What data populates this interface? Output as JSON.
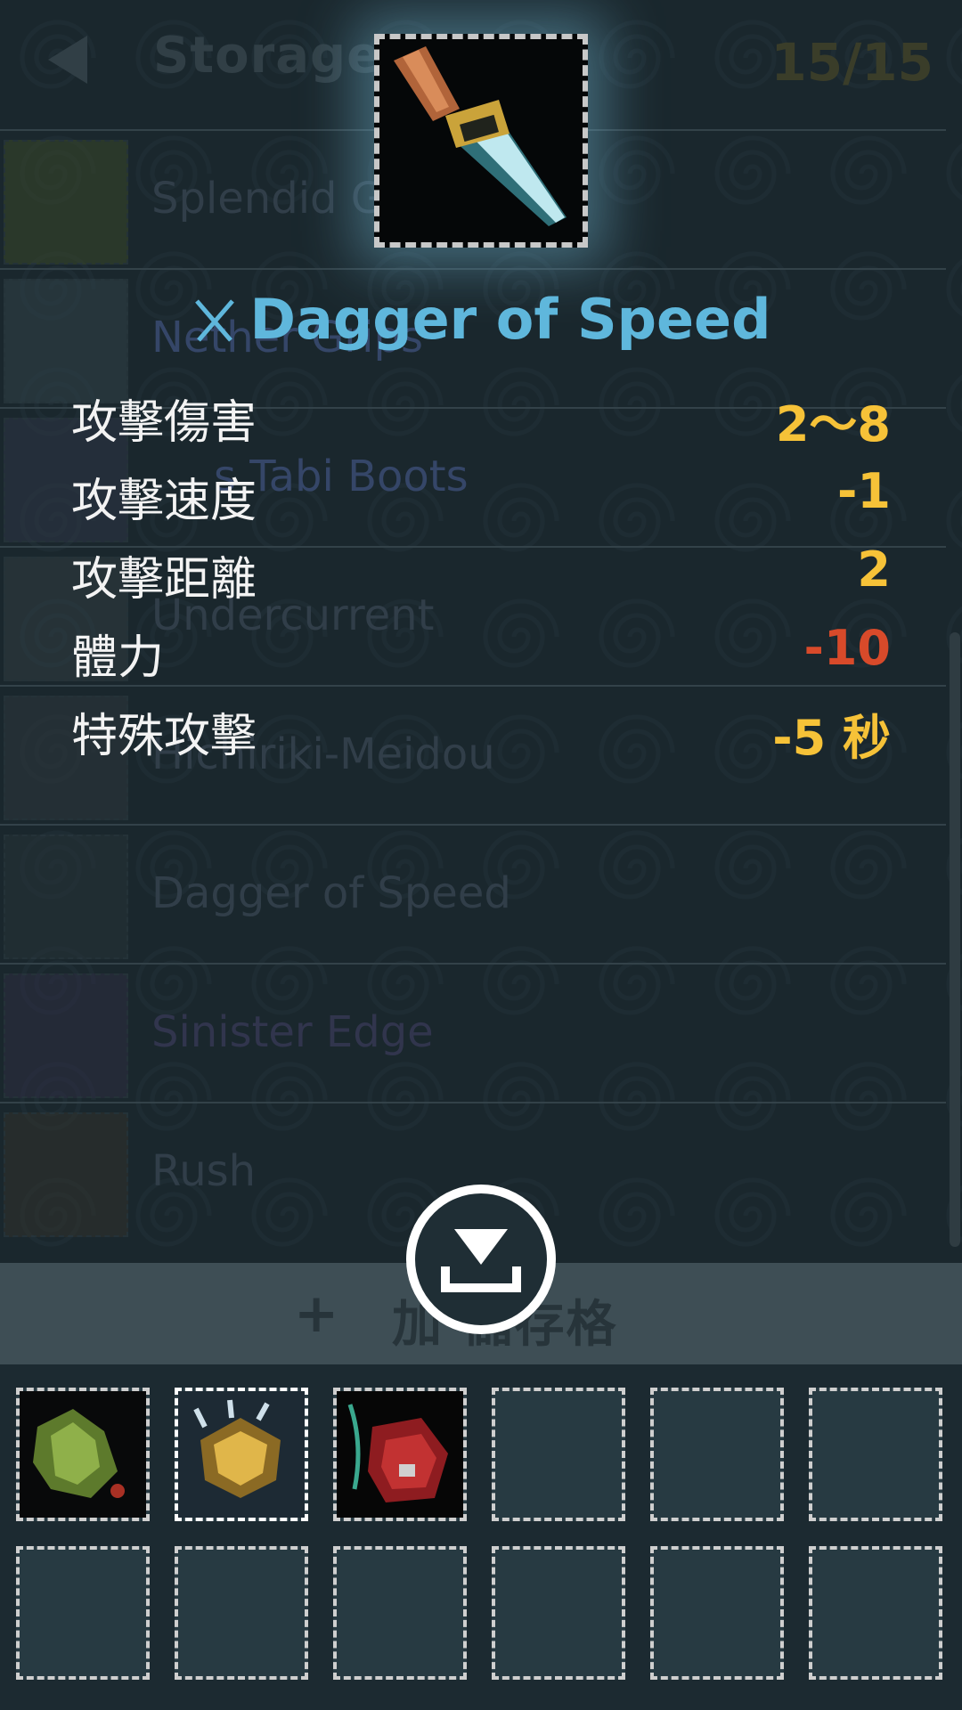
{
  "header": {
    "back_icon": "back-arrow-icon",
    "title": "Storage",
    "count": "15/15"
  },
  "storage_list": [
    {
      "name": "Splendid G",
      "icon": "gauntlet-icon"
    },
    {
      "name": "Nether Grips",
      "icon": "grips-icon"
    },
    {
      "name": "s Tabi Boots",
      "icon": "boots-icon"
    },
    {
      "name": "Undercurrent",
      "icon": "undercurrent-icon"
    },
    {
      "name": "Hichiriki-Meidou",
      "icon": "flute-icon"
    },
    {
      "name": "Dagger of Speed",
      "icon": "dagger-icon"
    },
    {
      "name": "Sinister Edge",
      "icon": "blade-icon"
    },
    {
      "name": "Rush",
      "icon": "rush-icon"
    }
  ],
  "detail": {
    "type_icon": "crossed-swords-icon",
    "item_icon": "dagger-icon",
    "title": "Dagger of Speed",
    "stats": [
      {
        "label": "攻擊傷害",
        "value": "2～8",
        "tone": "positive"
      },
      {
        "label": "攻擊速度",
        "value": "-1",
        "tone": "positive"
      },
      {
        "label": "攻擊距離",
        "value": "2",
        "tone": "positive"
      },
      {
        "label": "體力",
        "value": "-10",
        "tone": "negative"
      },
      {
        "label": "特殊攻擊",
        "value": "-5 秒",
        "tone": "positive"
      }
    ]
  },
  "expand": {
    "plus": "+",
    "label": "加 儲存格"
  },
  "store_button_icon": "store-down-icon",
  "inventory": [
    {
      "icon": "green-gauntlet-icon",
      "filled": true
    },
    {
      "icon": "gold-claw-icon",
      "filled": true,
      "selected": true
    },
    {
      "icon": "red-armor-icon",
      "filled": true
    },
    {
      "icon": "empty-slot",
      "filled": false
    },
    {
      "icon": "empty-slot",
      "filled": false
    },
    {
      "icon": "empty-slot",
      "filled": false
    },
    {
      "icon": "empty-slot",
      "filled": false
    },
    {
      "icon": "empty-slot",
      "filled": false
    },
    {
      "icon": "empty-slot",
      "filled": false
    },
    {
      "icon": "empty-slot",
      "filled": false
    },
    {
      "icon": "empty-slot",
      "filled": false
    },
    {
      "icon": "empty-slot",
      "filled": false
    }
  ],
  "colors": {
    "background": "#1d2a30",
    "title_accent": "#5fb7dc",
    "stat_positive": "#f6c238",
    "stat_negative": "#d84a2a",
    "stat_label": "#f3f3f3"
  }
}
